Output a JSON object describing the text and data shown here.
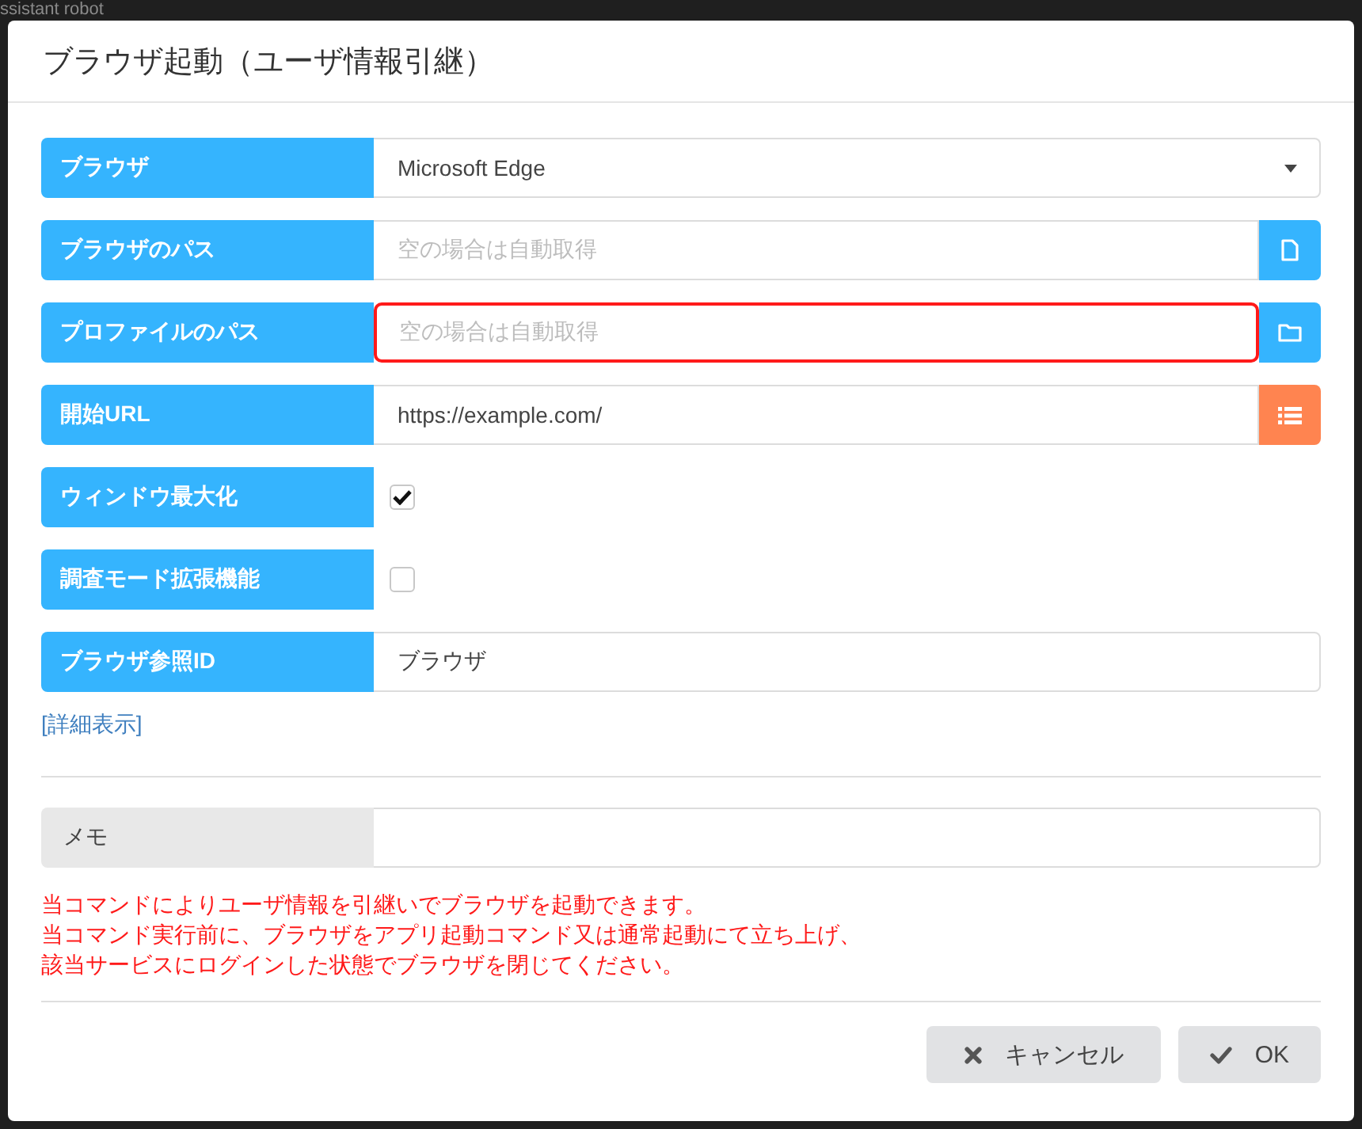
{
  "backdrop": {
    "page_title": "ssistant robot"
  },
  "dialog": {
    "title": "ブラウザ起動（ユーザ情報引継）",
    "fields": [
      {
        "kind": "select",
        "label": "ブラウザ",
        "value": "Microsoft Edge"
      },
      {
        "kind": "file",
        "label": "ブラウザのパス",
        "placeholder": "空の場合は自動取得",
        "highlighted": false
      },
      {
        "kind": "folder",
        "label": "プロファイルのパス",
        "placeholder": "空の場合は自動取得",
        "highlighted": true
      },
      {
        "kind": "url",
        "label": "開始URL",
        "value": "https://example.com/",
        "highlighted": false
      },
      {
        "kind": "checkbox",
        "label": "ウィンドウ最大化",
        "checked": true
      },
      {
        "kind": "checkbox",
        "label": "調査モード拡張機能",
        "checked": false
      },
      {
        "kind": "text",
        "label": "ブラウザ参照ID",
        "value": "ブラウザ",
        "highlighted": false
      }
    ],
    "details_link": "[詳細表示]",
    "memo": {
      "label": "メモ"
    },
    "notes": [
      "当コマンドによりユーザ情報を引継いでブラウザを起動できます。",
      "当コマンド実行前に、ブラウザをアプリ起動コマンド又は通常起動にて立ち上げ、",
      "該当サービスにログインした状態でブラウザを閉じてください。"
    ],
    "buttons": [
      {
        "kind": "cancel",
        "label": "キャンセル"
      },
      {
        "kind": "ok",
        "label": "OK"
      }
    ]
  }
}
